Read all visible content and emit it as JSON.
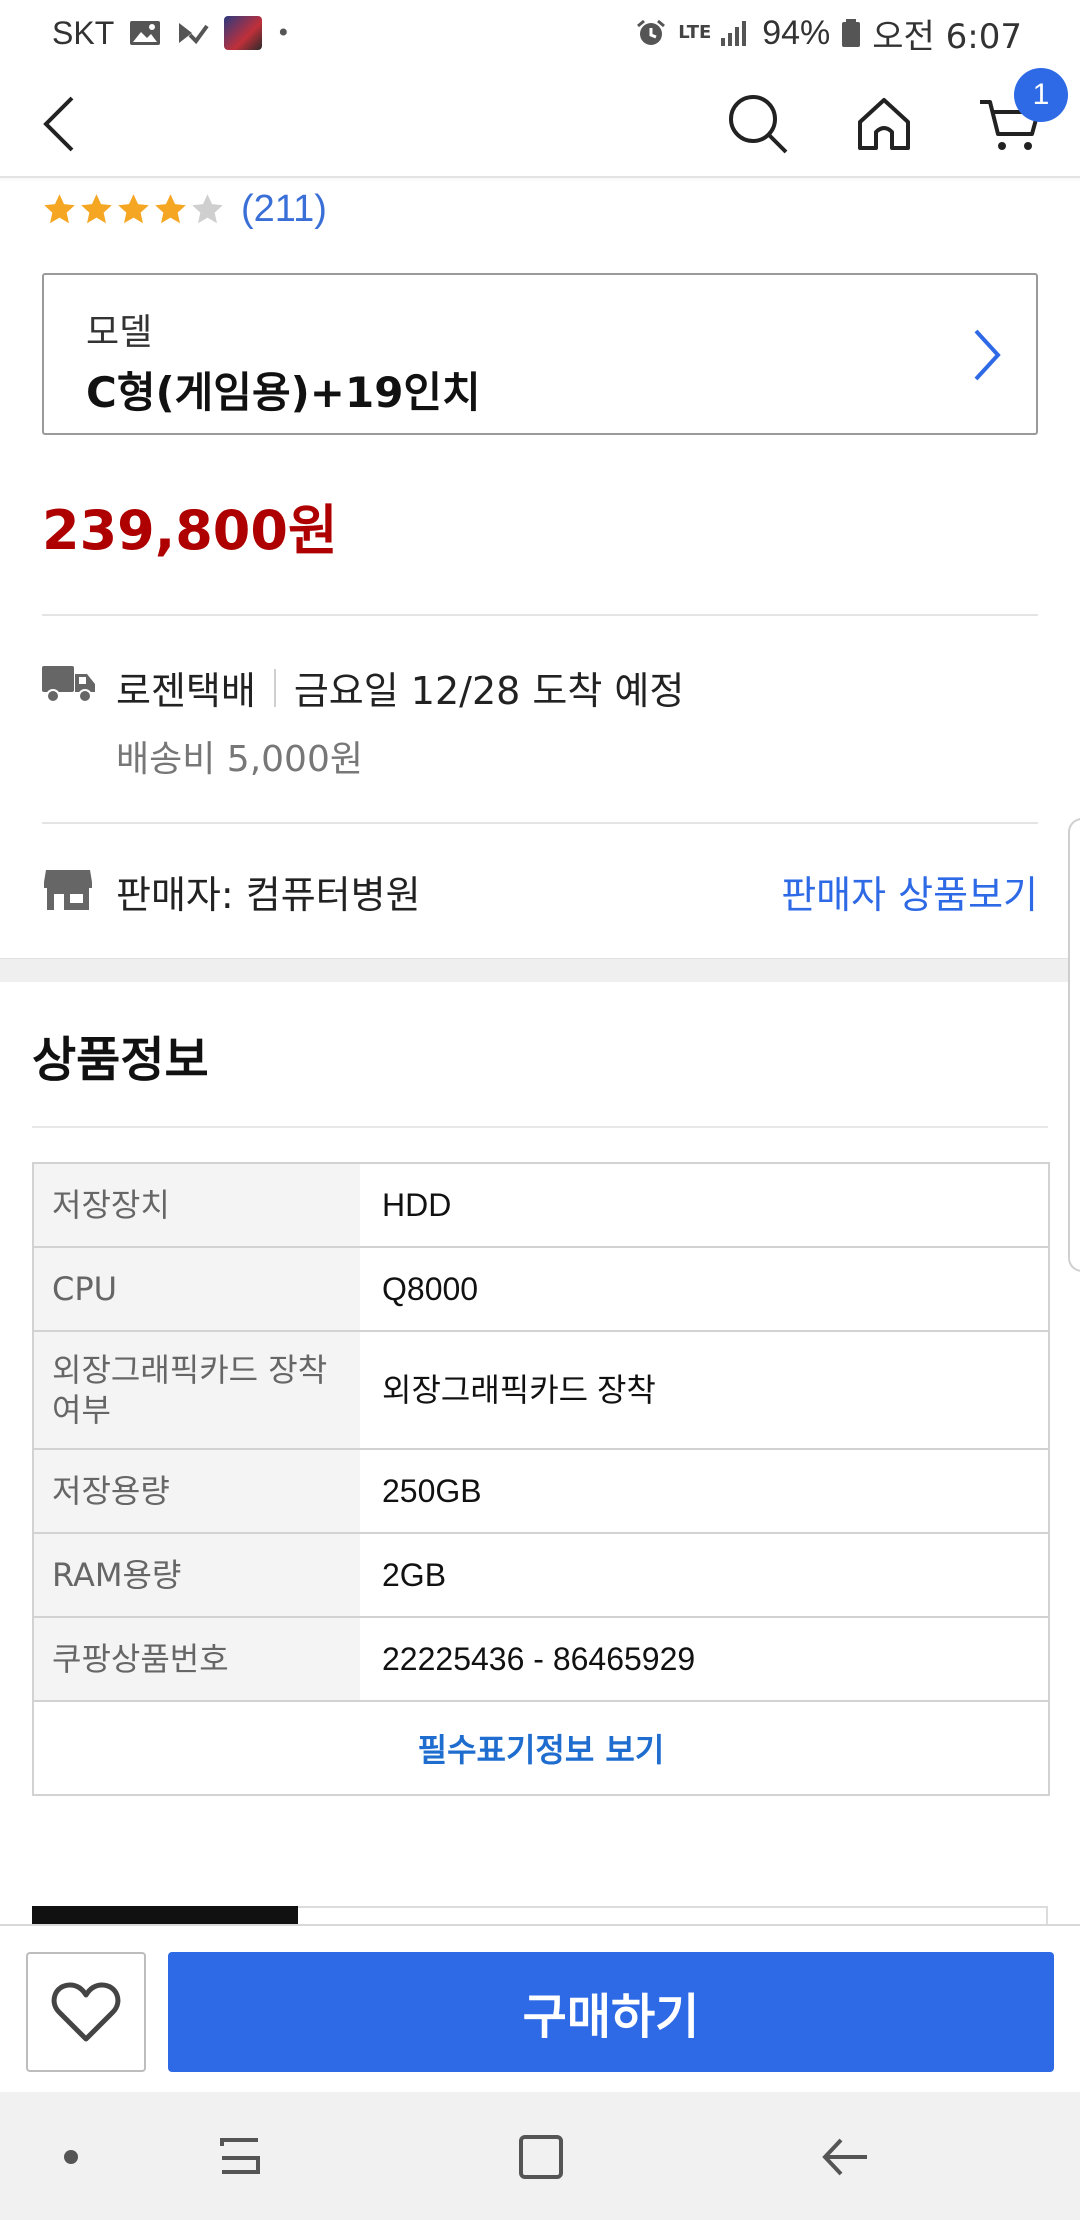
{
  "status_bar": {
    "carrier": "SKT",
    "network": "LTE",
    "battery": "94%",
    "time": "오전 6:07"
  },
  "header": {
    "cart_count": "1"
  },
  "product": {
    "rating_stars": 4,
    "rating_max": 5,
    "rating_count": "(211)",
    "model_label": "모델",
    "model_value": "C형(게임용)+19인치",
    "price": "239,800원"
  },
  "shipping": {
    "carrier": "로젠택배",
    "eta": "금요일 12/28 도착 예정",
    "fee": "배송비 5,000원"
  },
  "seller": {
    "name": "판매자: 컴퓨터병원",
    "link": "판매자 상품보기"
  },
  "info_section": {
    "title": "상품정보",
    "rows": [
      {
        "key": "저장장치",
        "value": "HDD"
      },
      {
        "key": "CPU",
        "value": "Q8000"
      },
      {
        "key": "외장그래픽카드 장착여부",
        "value": "외장그래픽카드 장착"
      },
      {
        "key": "저장용량",
        "value": "250GB"
      },
      {
        "key": "RAM용량",
        "value": "2GB"
      },
      {
        "key": "쿠팡상품번호",
        "value": "22225436 - 86465929"
      }
    ],
    "more_label": "필수표기정보 보기"
  },
  "buy_bar": {
    "buy_label": "구매하기"
  },
  "colors": {
    "accent": "#2f6ae6",
    "price": "#ae0000",
    "star": "#f5a623"
  }
}
